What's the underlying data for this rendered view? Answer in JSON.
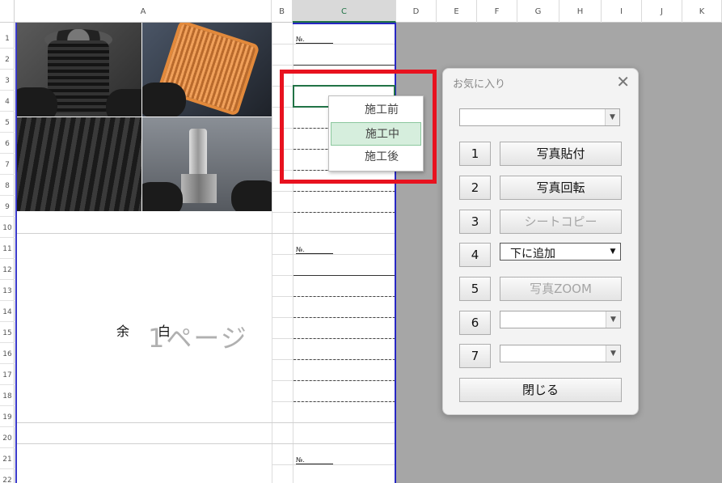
{
  "columns": [
    {
      "label": "A",
      "selected": false
    },
    {
      "label": "B",
      "selected": false
    },
    {
      "label": "C",
      "selected": true
    },
    {
      "label": "D",
      "selected": false
    },
    {
      "label": "E",
      "selected": false
    },
    {
      "label": "F",
      "selected": false
    },
    {
      "label": "G",
      "selected": false
    },
    {
      "label": "H",
      "selected": false
    },
    {
      "label": "I",
      "selected": false
    },
    {
      "label": "J",
      "selected": false
    },
    {
      "label": "K",
      "selected": false
    }
  ],
  "rows": [
    "1",
    "2",
    "3",
    "4",
    "5",
    "6",
    "7",
    "8",
    "9",
    "10",
    "11",
    "12",
    "13",
    "14",
    "15",
    "16",
    "17",
    "18",
    "19",
    "20",
    "21",
    "22"
  ],
  "sheet": {
    "page_label": "1ページ",
    "margin_char_1": "余",
    "margin_char_2": "白",
    "no_label": "№."
  },
  "dropdown": {
    "items": [
      {
        "label": "施工前",
        "active": false
      },
      {
        "label": "施工中",
        "active": true
      },
      {
        "label": "施工後",
        "active": false
      }
    ]
  },
  "dialog": {
    "title": "お気に入り",
    "close_glyph": "✕",
    "top_combo_value": "",
    "combo_arrow": "▼",
    "rows": [
      {
        "num": "1",
        "label": "写真貼付",
        "enabled": true
      },
      {
        "num": "2",
        "label": "写真回転",
        "enabled": true
      },
      {
        "num": "3",
        "label": "シートコピー",
        "enabled": false
      },
      {
        "num": "4",
        "combo_value": "下に追加"
      },
      {
        "num": "5",
        "label": "写真ZOOM",
        "enabled": false
      },
      {
        "num": "6",
        "combo_value": ""
      },
      {
        "num": "7",
        "combo_value": ""
      }
    ],
    "close_button": "閉じる"
  },
  "colors": {
    "excel_green": "#217346",
    "highlight_red": "#e8121f",
    "print_border_blue": "#2727c4",
    "outside_gray": "#a6a6a6"
  }
}
